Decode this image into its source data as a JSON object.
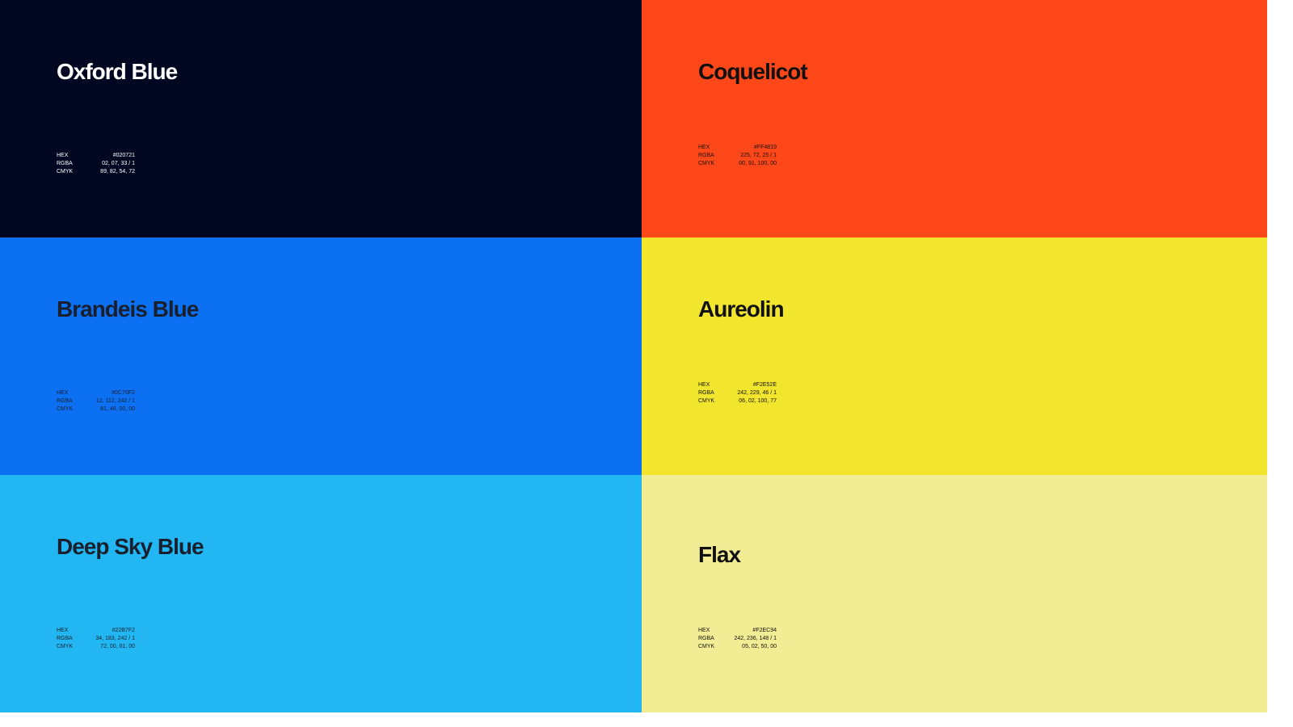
{
  "swatches": [
    {
      "name": "Oxford Blue",
      "bg": "#020721",
      "text_color": "#ffffff",
      "specs": [
        {
          "label": "HEX",
          "value": "#020721"
        },
        {
          "label": "RGBA",
          "value": "02, 07, 33 / 1"
        },
        {
          "label": "CMYK",
          "value": "89, 82, 54, 72"
        }
      ]
    },
    {
      "name": "Coquelicot",
      "bg": "#FF4819",
      "text_color": "#111111",
      "specs": [
        {
          "label": "HEX",
          "value": "#FF4819"
        },
        {
          "label": "RGBA",
          "value": "225, 72, 25 / 1"
        },
        {
          "label": "CMYK",
          "value": "00, 91, 100, 00"
        }
      ]
    },
    {
      "name": "Brandeis Blue",
      "bg": "#0C70F2",
      "text_color": "#1a1f2e",
      "specs": [
        {
          "label": "HEX",
          "value": "#0C70F2"
        },
        {
          "label": "RGBA",
          "value": "12, 112, 242 / 1"
        },
        {
          "label": "CMYK",
          "value": "81, 46, 00, 00"
        }
      ]
    },
    {
      "name": "Aureolin",
      "bg": "#F2E52E",
      "text_color": "#111111",
      "specs": [
        {
          "label": "HEX",
          "value": "#F2E52E"
        },
        {
          "label": "RGBA",
          "value": "242, 229, 46 / 1"
        },
        {
          "label": "CMYK",
          "value": "06, 02, 100, 77"
        }
      ]
    },
    {
      "name": "Deep Sky Blue",
      "bg": "#22B7F2",
      "text_color": "#1a1f2e",
      "specs": [
        {
          "label": "HEX",
          "value": "#22B7F2"
        },
        {
          "label": "RGBA",
          "value": "34, 183, 242 / 1"
        },
        {
          "label": "CMYK",
          "value": "72, 00, 01, 00"
        }
      ]
    },
    {
      "name": "Flax",
      "bg": "#F2EC94",
      "text_color": "#111111",
      "specs": [
        {
          "label": "HEX",
          "value": "#F2EC94"
        },
        {
          "label": "RGBA",
          "value": "242, 236, 148 / 1"
        },
        {
          "label": "CMYK",
          "value": "05, 02, 50, 00"
        }
      ]
    }
  ]
}
